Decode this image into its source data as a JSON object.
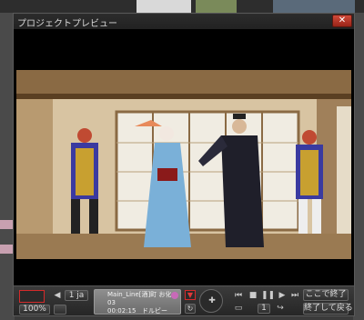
{
  "window": {
    "title": "プロジェクトプレビュー",
    "close_symbol": "✕"
  },
  "controls": {
    "zoom_value": "100%",
    "volume_value": "1 ja",
    "clip_name": "Main_Line[酒]町 お化...",
    "clip_field2": "03",
    "clip_timecode": "00:02:15",
    "clip_label": "ドルビー",
    "finish_here_label": "ここで終了",
    "finish_and_return_label": "終了して戻る",
    "frame_field": "1"
  },
  "icons": [
    "close-icon",
    "speaker-icon",
    "skip-back-icon",
    "stop-icon",
    "pause-icon",
    "play-icon",
    "skip-forward-icon",
    "marker-icon",
    "loop-icon",
    "nav-pad-icon"
  ],
  "colors": {
    "accent_red": "#d42a2a",
    "window_bg": "#1c1c1c",
    "control_bg": "#333333"
  }
}
